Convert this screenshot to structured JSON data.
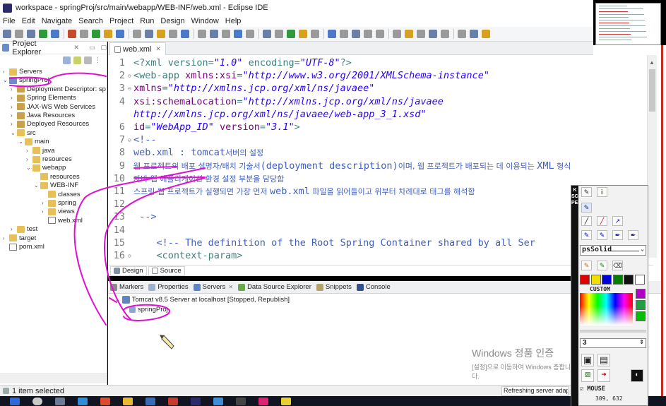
{
  "window": {
    "title": "workspace - springProj/src/main/webapp/WEB-INF/web.xml - Eclipse IDE"
  },
  "menu": [
    "File",
    "Edit",
    "Navigate",
    "Search",
    "Project",
    "Run",
    "Design",
    "Window",
    "Help"
  ],
  "explorer": {
    "title": "Project Explorer",
    "tree": [
      {
        "label": "Servers",
        "depth": 0,
        "expanded": false,
        "icon": "folder-icon"
      },
      {
        "label": "springProj",
        "depth": 0,
        "expanded": true,
        "icon": "project-icon"
      },
      {
        "label": "Deployment Descriptor: sp",
        "depth": 1,
        "expanded": false,
        "icon": "descriptor-icon"
      },
      {
        "label": "Spring Elements",
        "depth": 1,
        "expanded": false,
        "icon": "spring-icon"
      },
      {
        "label": "JAX-WS Web Services",
        "depth": 1,
        "expanded": false,
        "icon": "webservice-icon"
      },
      {
        "label": "Java Resources",
        "depth": 1,
        "expanded": false,
        "icon": "java-resources-icon"
      },
      {
        "label": "Deployed Resources",
        "depth": 1,
        "expanded": false,
        "icon": "deployed-icon"
      },
      {
        "label": "src",
        "depth": 1,
        "expanded": true,
        "icon": "folder-icon"
      },
      {
        "label": "main",
        "depth": 2,
        "expanded": true,
        "icon": "folder-icon"
      },
      {
        "label": "java",
        "depth": 3,
        "expanded": false,
        "icon": "folder-icon"
      },
      {
        "label": "resources",
        "depth": 3,
        "expanded": false,
        "icon": "folder-icon"
      },
      {
        "label": "webapp",
        "depth": 3,
        "expanded": true,
        "icon": "folder-icon"
      },
      {
        "label": "resources",
        "depth": 4,
        "expanded": null,
        "icon": "folder-icon"
      },
      {
        "label": "WEB-INF",
        "depth": 4,
        "expanded": true,
        "icon": "folder-icon"
      },
      {
        "label": "classes",
        "depth": 5,
        "expanded": null,
        "icon": "folder-icon"
      },
      {
        "label": "spring",
        "depth": 5,
        "expanded": false,
        "icon": "folder-icon"
      },
      {
        "label": "views",
        "depth": 5,
        "expanded": false,
        "icon": "folder-icon"
      },
      {
        "label": "web.xml",
        "depth": 5,
        "expanded": null,
        "icon": "xml-file-icon"
      },
      {
        "label": "test",
        "depth": 1,
        "expanded": false,
        "icon": "folder-icon"
      },
      {
        "label": "target",
        "depth": 0,
        "expanded": false,
        "icon": "folder-icon"
      },
      {
        "label": "pom.xml",
        "depth": 0,
        "expanded": null,
        "icon": "xml-file-icon"
      }
    ]
  },
  "editor": {
    "tab": "web.xml",
    "lines": [
      {
        "n": "1",
        "fold": "",
        "parts": [
          [
            "pi",
            "<?xml version="
          ],
          [
            "str",
            "\"1.0\""
          ],
          [
            "pi",
            " encoding="
          ],
          [
            "str",
            "\"UTF-8\""
          ],
          [
            "pi",
            "?>"
          ]
        ]
      },
      {
        "n": "2",
        "fold": "⊖",
        "parts": [
          [
            "tag",
            "<web-app "
          ],
          [
            "attr",
            "xmlns:xsi"
          ],
          [
            "tag",
            "="
          ],
          [
            "str",
            "\"http://www.w3.org/2001/XMLSchema-instance\""
          ]
        ]
      },
      {
        "n": "3",
        "fold": "⊖",
        "parts": [
          [
            "attr",
            "xmlns"
          ],
          [
            "tag",
            "="
          ],
          [
            "str",
            "\"http://xmlns.jcp.org/xml/ns/javaee\""
          ]
        ]
      },
      {
        "n": "4",
        "fold": "",
        "parts": [
          [
            "attr",
            "xsi:schemaLocation"
          ],
          [
            "tag",
            "="
          ],
          [
            "str",
            "\"http://xmlns.jcp.org/xml/ns/javaee"
          ]
        ]
      },
      {
        "n": "",
        "fold": "",
        "parts": [
          [
            "str",
            "http://xmlns.jcp.org/xml/ns/javaee/web-app_3_1.xsd\""
          ]
        ]
      },
      {
        "n": "6",
        "fold": "",
        "parts": [
          [
            "attr",
            "id"
          ],
          [
            "tag",
            "="
          ],
          [
            "str",
            "\"WebApp_ID\""
          ],
          [
            "tag",
            " "
          ],
          [
            "attr",
            "version"
          ],
          [
            "tag",
            "="
          ],
          [
            "str",
            "\"3.1\""
          ],
          [
            "tag",
            ">"
          ]
        ]
      },
      {
        "n": "7",
        "fold": "⊖",
        "parts": [
          [
            "com",
            "<!--"
          ]
        ]
      },
      {
        "n": "8",
        "fold": "",
        "parts": [
          [
            "com",
            "web.xml : tomcat"
          ],
          [
            "kor",
            "서버의 설정"
          ]
        ]
      },
      {
        "n": "9",
        "fold": "",
        "parts": [
          [
            "kor",
            "웹 프로젝트의 배포 설명자/배치 기술서"
          ],
          [
            "com",
            "(deployment description)"
          ],
          [
            "kor",
            "이며, 웹 프로젝트가 배포되는 데 이용되는 "
          ],
          [
            "com",
            "XML"
          ],
          [
            "kor",
            " 형식"
          ]
        ]
      },
      {
        "n": "10",
        "fold": "",
        "parts": [
          [
            "kor",
            "자바 웹 애플리케이션 환경 설정 부분을 담당함"
          ]
        ]
      },
      {
        "n": "11",
        "fold": "",
        "parts": [
          [
            "kor",
            "스프링 웹 프로젝트가 실행되면 가장 먼저 "
          ],
          [
            "com",
            "web.xml"
          ],
          [
            "kor",
            " 파일을 읽어들이고 위부터 차례대로 태그를 해석함"
          ]
        ]
      },
      {
        "n": "12",
        "fold": "",
        "parts": []
      },
      {
        "n": "13",
        "fold": "",
        "parts": [
          [
            "com",
            " -->"
          ]
        ]
      },
      {
        "n": "14",
        "fold": "",
        "parts": []
      },
      {
        "n": "15",
        "fold": "",
        "parts": [
          [
            "com",
            "    <!-- The definition of the Root Spring Container shared by all Ser"
          ]
        ]
      },
      {
        "n": "16",
        "fold": "⊖",
        "parts": [
          [
            "tag",
            "    <context-param>"
          ]
        ]
      }
    ]
  },
  "design_tabs": [
    "Design",
    "Source"
  ],
  "bottom": {
    "tabs": [
      "Markers",
      "Properties",
      "Servers",
      "Data Source Explorer",
      "Snippets",
      "Console"
    ],
    "server": "Tomcat v8.5 Server at localhost  [Stopped, Republish]",
    "server_child": "springProj"
  },
  "status": {
    "left": "1 item selected",
    "right": "Refreshing server adapter"
  },
  "watermark": {
    "line1": "Windows 정품 인증",
    "line2": "[설정]으로 이동하여 Windows",
    "line3": "다.",
    "line2_tail": "증합니"
  },
  "screenpen": {
    "side_text": "K SCREEN PEN",
    "style": "psSolid",
    "custom_label": "CUSTOM",
    "size": "3",
    "mouse_label": "MOUSE",
    "coords": "309,  632",
    "colors": [
      "#e00000",
      "#f0e000",
      "#0000d8",
      "#008000",
      "#111111",
      "#ffffff"
    ],
    "side_colors": [
      "#b000c8",
      "#20a040",
      "#00c000"
    ]
  },
  "colors": {
    "annotation": "#e010d0",
    "accent_red": "#c42b1c"
  }
}
